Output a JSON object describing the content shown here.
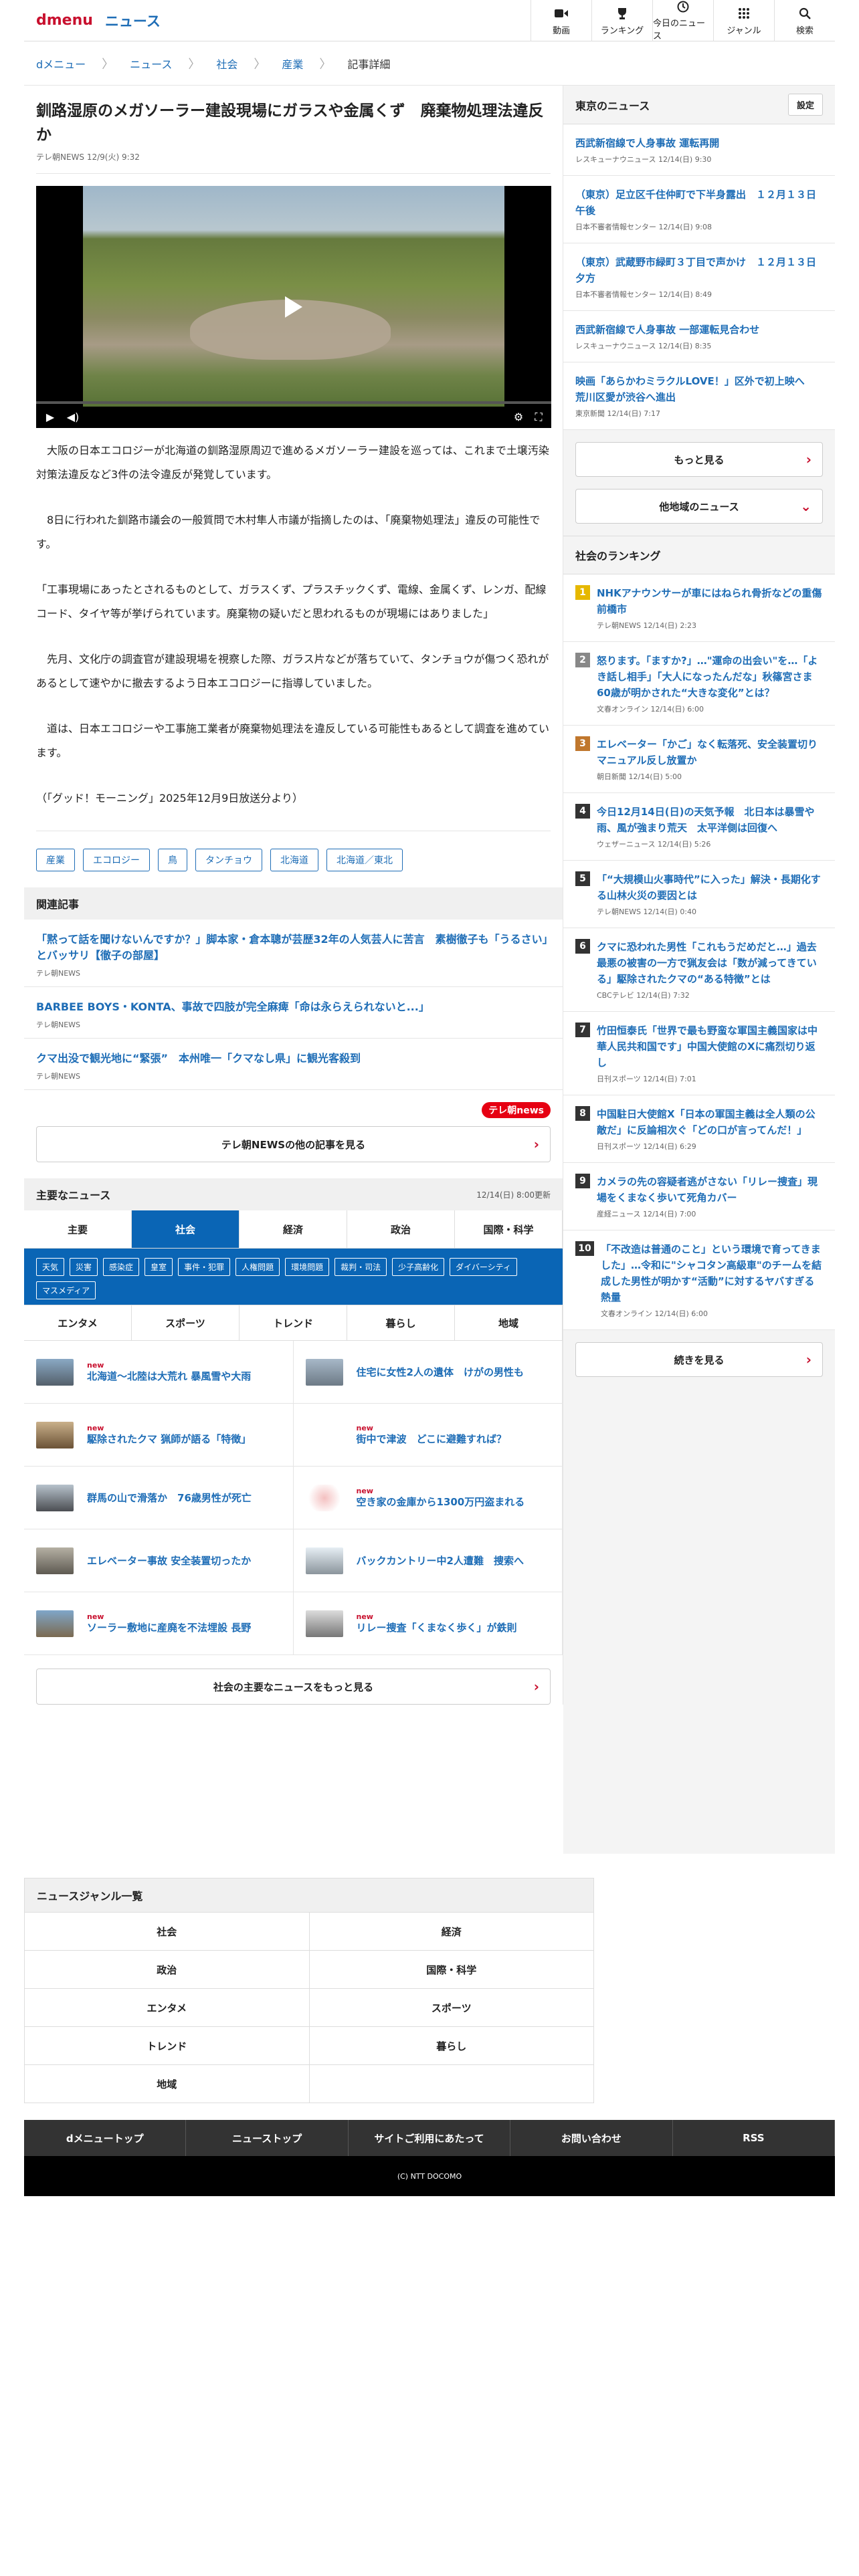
{
  "header": {
    "logo_d": "d",
    "logo_menu": "menu",
    "logo_news": "ニュース",
    "nav": [
      "動画",
      "ランキング",
      "今日のニュース",
      "ジャンル",
      "検索"
    ]
  },
  "breadcrumb": [
    "dメニュー",
    "ニュース",
    "社会",
    "産業",
    "記事詳細"
  ],
  "article": {
    "title": "釧路湿原のメガソーラー建設現場にガラスや金属くず　廃棄物処理法違反か",
    "source": "テレ朝NEWS 12/9(火) 9:32",
    "paragraphs": [
      "　大阪の日本エコロジーが北海道の釧路湿原周辺で進めるメガソーラー建設を巡っては、これまで土壌汚染対策法違反など3件の法令違反が発覚しています。",
      "　8日に行われた釧路市議会の一般質問で木村隼人市議が指摘したのは、「廃棄物処理法」違反の可能性です。",
      "「工事現場にあったとされるものとして、ガラスくず、プラスチックくず、電線、金属くず、レンガ、配線コード、タイヤ等が挙げられています。廃棄物の疑いだと思われるものが現場にはありました」",
      "　先月、文化庁の調査官が建設現場を視察した際、ガラス片などが落ちていて、タンチョウが傷つく恐れがあるとして速やかに撤去するよう日本エコロジーに指導していました。",
      "　道は、日本エコロジーや工事施工業者が廃棄物処理法を違反している可能性もあるとして調査を進めています。",
      "（「グッド！モーニング」2025年12月9日放送分より）"
    ],
    "tags": [
      "産業",
      "エコロジー",
      "鳥",
      "タンチョウ",
      "北海道",
      "北海道／東北"
    ]
  },
  "related": {
    "heading": "関連記事",
    "items": [
      {
        "title": "「黙って話を聞けないんですか？」脚本家・倉本聰が芸歴32年の人気芸人に苦言　素樹徹子も「うるさい」とバッサリ【徹子の部屋】",
        "source": "テレ朝NEWS"
      },
      {
        "title": "BARBEE BOYS・KONTA、事故で四肢が完全麻痺「命は永らえられないと...」",
        "source": "テレ朝NEWS"
      },
      {
        "title": "クマ出没で観光地に“緊張”　本州唯一「クマなし県」に観光客殺到",
        "source": "テレ朝NEWS"
      }
    ],
    "tv_logo": "テレ朝news",
    "more": "テレ朝NEWSの他の記事を見る"
  },
  "major": {
    "heading": "主要なニュース",
    "updated": "12/14(日) 8:00更新",
    "tabs": [
      "主要",
      "社会",
      "経済",
      "政治",
      "国際・科学"
    ],
    "subtags": [
      "天気",
      "災害",
      "感染症",
      "皇室",
      "事件・犯罪",
      "人権問題",
      "環境問題",
      "裁判・司法",
      "少子高齢化",
      "ダイバーシティ",
      "マスメディア"
    ],
    "tabs2": [
      "エンタメ",
      "スポーツ",
      "トレンド",
      "暮らし",
      "地域"
    ],
    "items": [
      {
        "new": "new",
        "title": "北海道～北陸は大荒れ 暴風雪や大雨"
      },
      {
        "new": "",
        "title": "住宅に女性2人の遺体　けがの男性も"
      },
      {
        "new": "new",
        "title": "駆除されたクマ 猟師が語る「特徴」"
      },
      {
        "new": "new",
        "title": "街中で津波　どこに避難すれば？"
      },
      {
        "new": "",
        "title": "群馬の山で滑落か　76歳男性が死亡"
      },
      {
        "new": "new",
        "title": "空き家の金庫から1300万円盗まれる"
      },
      {
        "new": "",
        "title": "エレベーター事故 安全装置切ったか"
      },
      {
        "new": "",
        "title": "バックカントリー中2人遭難　捜索へ"
      },
      {
        "new": "new",
        "title": "ソーラー敷地に産廃を不法埋設 長野"
      },
      {
        "new": "new",
        "title": "リレー捜査「くまなく歩く」が鉄則"
      }
    ],
    "more": "社会の主要なニュースをもっと見る"
  },
  "side": {
    "tokyo_heading": "東京のニュース",
    "setting": "設定",
    "tokyo": [
      {
        "title": "西武新宿線で人身事故 運転再開",
        "source": "レスキューナウニュース 12/14(日) 9:30"
      },
      {
        "title": "（東京）足立区千住仲町で下半身露出　１２月１３日午後",
        "source": "日本不審者情報センター 12/14(日) 9:08"
      },
      {
        "title": "（東京）武蔵野市緑町３丁目で声かけ　１２月１３日夕方",
        "source": "日本不審者情報センター 12/14(日) 8:49"
      },
      {
        "title": "西武新宿線で人身事故 一部運転見合わせ",
        "source": "レスキューナウニュース 12/14(日) 8:35"
      },
      {
        "title": "映画「あらかわミラクルLOVE！」区外で初上映へ　荒川区愛が渋谷へ進出",
        "source": "東京新聞 12/14(日) 7:17"
      }
    ],
    "more": "もっと見る",
    "other": "他地域のニュース",
    "rank_heading": "社会のランキング",
    "ranking": [
      {
        "n": "1",
        "title": "NHKアナウンサーが車にはねられ骨折などの重傷　前橋市",
        "source": "テレ朝NEWS 12/14(日) 2:23"
      },
      {
        "n": "2",
        "title": "怒ります。「ますか?」…\"運命の出会い\"を…「よき話し相手」「大人になったんだな」秋篠宮さま60歳が明かされた“大きな変化”とは？",
        "source": "文春オンライン 12/14(日) 6:00"
      },
      {
        "n": "3",
        "title": "エレベーター「かご」なく転落死、安全装置切りマニュアル反し放置か",
        "source": "朝日新聞 12/14(日) 5:00"
      },
      {
        "n": "4",
        "title": "今日12月14日(日)の天気予報　北日本は暴雪や雨、風が強まり荒天　太平洋側は回復へ",
        "source": "ウェザーニュース 12/14(日) 5:26"
      },
      {
        "n": "5",
        "title": "「“大規模山火事時代”に入った」解決・長期化する山林火災の要因とは",
        "source": "テレ朝NEWS 12/14(日) 0:40"
      },
      {
        "n": "6",
        "title": "クマに恐われた男性「これもうだめだと…」過去最悪の被害の一方で猟友会は「数が減ってきている」駆除されたクマの“ある特徴”とは",
        "source": "CBCテレビ 12/14(日) 7:32"
      },
      {
        "n": "7",
        "title": "竹田恒泰氏「世界で最も野蛮な軍国主義国家は中華人民共和国です」中国大使館のXに痛烈切り返し",
        "source": "日刊スポーツ 12/14(日) 7:01"
      },
      {
        "n": "8",
        "title": "中国駐日大使館X「日本の軍国主義は全人類の公敵だ」に反論相次ぐ「どの口が言ってんだ！」",
        "source": "日刊スポーツ 12/14(日) 6:29"
      },
      {
        "n": "9",
        "title": "カメラの先の容疑者逃がさない「リレー捜査」現場をくまなく歩いて死角カバー",
        "source": "産経ニュース 12/14(日) 7:00"
      },
      {
        "n": "10",
        "title": "「不改造は普通のこと」という環境で育ってきました」…令和に\"シャコタン高級車\"のチームを結成した男性が明かす“活動”に対するヤバすぎる熱量",
        "source": "文春オンライン 12/14(日) 6:00"
      }
    ],
    "rank_more": "続きを見る"
  },
  "genre": {
    "heading": "ニュースジャンル一覧",
    "items": [
      "社会",
      "経済",
      "政治",
      "国際・科学",
      "エンタメ",
      "スポーツ",
      "トレンド",
      "暮らし",
      "地域",
      ""
    ]
  },
  "footer": {
    "links": [
      "dメニュートップ",
      "ニューストップ",
      "サイトご利用にあたって",
      "お問い合わせ",
      "RSS"
    ],
    "copyright": "(C) NTT DOCOMO"
  },
  "colors": {
    "accent": "#c8102e",
    "link": "#1e6db6",
    "tab_active": "#0a65b5",
    "rank1": "#e6b800",
    "rank2": "#888888",
    "rank3": "#c0772d"
  }
}
